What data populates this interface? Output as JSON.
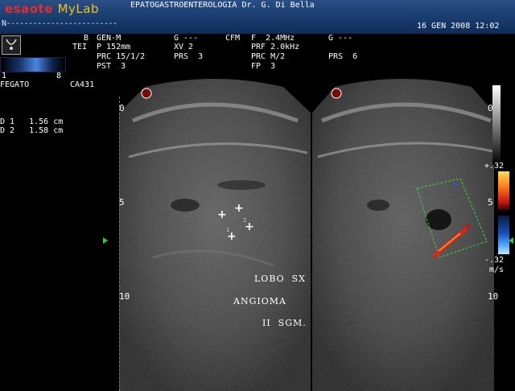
{
  "header": {
    "brand": "esaote",
    "product": "MyLab",
    "institution": "EPATOGASTROENTEROLOGIA Dr. G. Di Bella",
    "ruler_text": "N-------------------------",
    "date": "16 GEN 2008",
    "time": "12:02"
  },
  "bmode": {
    "mode": "B",
    "gen": "GEN-M",
    "tei": "TEI",
    "p": "P 152mm",
    "prc": "PRC 15/1/2",
    "pst": "PST  3",
    "g": "G ---",
    "xv": "XV 2",
    "prs": "PRS  3"
  },
  "cfm": {
    "label": "CFM",
    "f": "F  2.4MHz",
    "prf": "PRF 2.0kHz",
    "prc": "PRC M/2",
    "fp": "FP  3",
    "g": "G ---",
    "prs": "PRS  6"
  },
  "left_panel": {
    "range_min": "1",
    "range_max": "8",
    "organ": "FEGATO",
    "probe": "CA431",
    "measurements": [
      {
        "label": "D 1",
        "value": "1.56",
        "unit": "cm"
      },
      {
        "label": "D 2",
        "value": "1.58",
        "unit": "cm"
      }
    ]
  },
  "depth_left": [
    "0",
    "5",
    "10"
  ],
  "depth_right": [
    "0",
    "5",
    "10"
  ],
  "color_scale": {
    "pos": "+.32",
    "neg": "-.32",
    "unit": "m/s"
  },
  "annotations": [
    "LOBO  SX",
    "ANGIOMA",
    "II  SGM."
  ],
  "caliper_labels": [
    "1",
    "2"
  ],
  "colors": {
    "header_bg": "#173a6c",
    "brand_red": "#e32d2d",
    "brand_yellow": "#f1c11b",
    "marker_green": "#2bd42b",
    "roi_green": "#3ad63a"
  }
}
